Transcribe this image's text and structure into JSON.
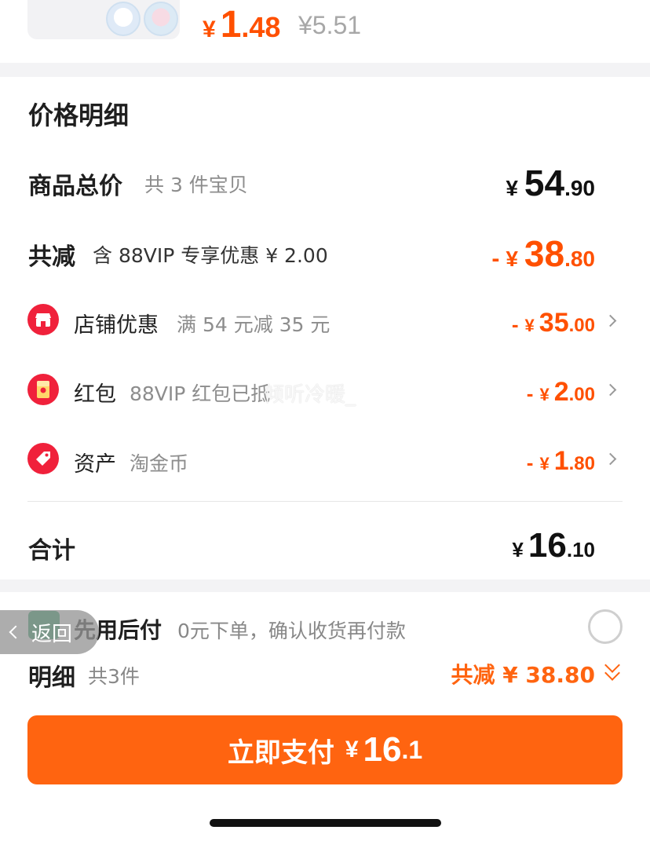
{
  "product": {
    "price_currency": "¥",
    "price_int": "1",
    "price_dec": ".48",
    "original_price": "¥5.51"
  },
  "price_detail": {
    "title": "价格明细",
    "total": {
      "label": "商品总价",
      "sub": "共 3 件宝贝",
      "currency": "¥",
      "int": "54",
      "dec": ".90"
    },
    "discount": {
      "label": "共减",
      "sub": "含 88VIP 专享优惠 ¥ 2.00",
      "minus": "-",
      "currency": "¥",
      "int": "38",
      "dec": ".80"
    },
    "items": [
      {
        "label": "店铺优惠",
        "sub": "满 54 元减 35 元",
        "minus": "-",
        "currency": "¥",
        "int": "35",
        "dec": ".00",
        "icon": "shop-icon"
      },
      {
        "label": "红包",
        "sub": "88VIP 红包已抵",
        "minus": "-",
        "currency": "¥",
        "int": "2",
        "dec": ".00",
        "icon": "red-packet-icon"
      },
      {
        "label": "资产",
        "sub": "淘金币",
        "minus": "-",
        "currency": "¥",
        "int": "1",
        "dec": ".80",
        "icon": "coin-tag-icon"
      }
    ],
    "subtotal": {
      "label": "合计",
      "currency": "¥",
      "int": "16",
      "dec": ".10"
    }
  },
  "watermark": "倾听冷暖_",
  "back_button": {
    "label": "返回"
  },
  "pay_later": {
    "label": "先用后付",
    "sub": "0元下单，确认收货再付款"
  },
  "summary": {
    "label": "明细",
    "sub": "共3件",
    "discount_text": "共减 ¥ 38.80"
  },
  "pay_button": {
    "label": "立即支付",
    "currency": "¥",
    "int": "16",
    "dec": ".1"
  },
  "colors": {
    "accent": "#ff5000",
    "button": "#ff6410",
    "icon_red": "#f0213b"
  }
}
